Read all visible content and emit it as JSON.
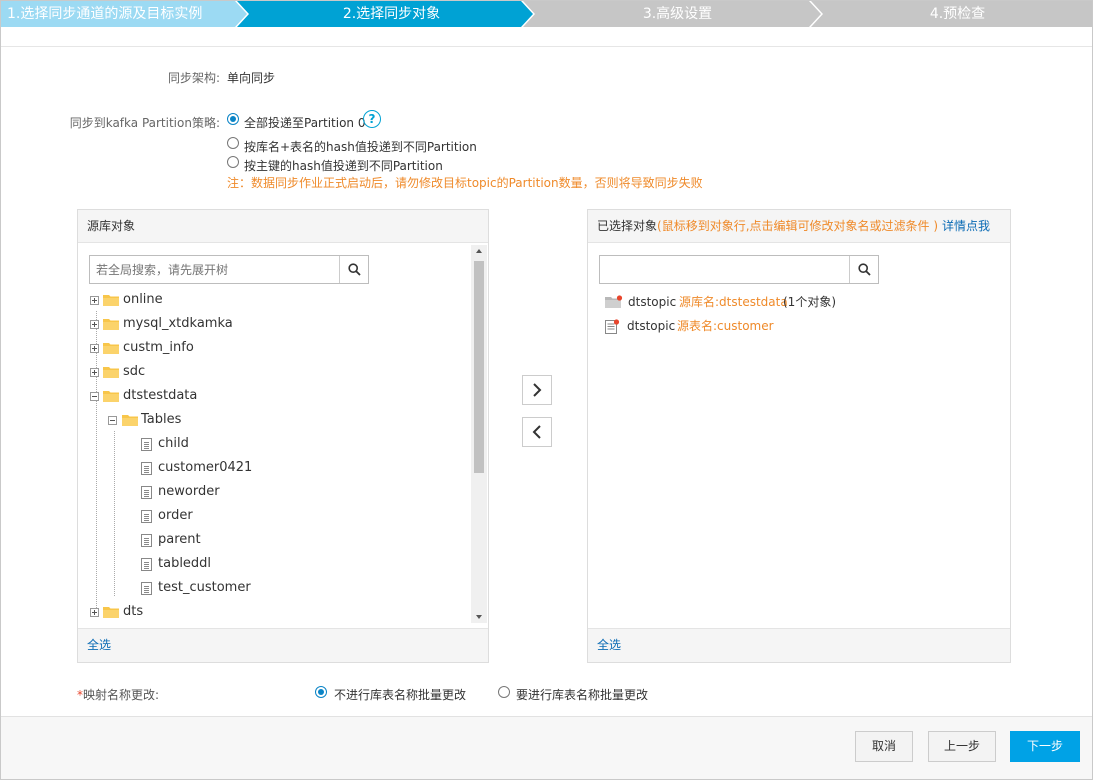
{
  "steps": [
    {
      "label": "1.选择同步通道的源及目标实例",
      "state": "done"
    },
    {
      "label": "2.选择同步对象",
      "state": "active"
    },
    {
      "label": "3.高级设置",
      "state": "pending"
    },
    {
      "label": "4.预检查",
      "state": "pending"
    }
  ],
  "colors": {
    "done": "#9cdaf3",
    "active": "#00a2d4",
    "pending": "#c6c6c6",
    "accent": "#0a84c6",
    "warn": "#ef8a2a"
  },
  "form": {
    "arch_label": "同步架构:",
    "arch_value": "单向同步",
    "partition_label": "同步到kafka Partition策略:",
    "partition_options": [
      {
        "label": "全部投递至Partition 0",
        "selected": true
      },
      {
        "label": "按库名+表名的hash值投递到不同Partition",
        "selected": false
      },
      {
        "label": "按主键的hash值投递到不同Partition",
        "selected": false
      }
    ],
    "help_glyph": "?",
    "warning": "注：数据同步作业正式启动后，请勿修改目标topic的Partition数量，否则将导致同步失败"
  },
  "source_panel": {
    "title": "源库对象",
    "search_placeholder": "若全局搜索，请先展开树",
    "select_all": "全选",
    "tree": [
      {
        "label": "online",
        "type": "db",
        "expanded": false
      },
      {
        "label": "mysql_xtdkamka",
        "type": "db",
        "expanded": false
      },
      {
        "label": "custm_info",
        "type": "db",
        "expanded": false
      },
      {
        "label": "sdc",
        "type": "db",
        "expanded": false
      },
      {
        "label": "dtstestdata",
        "type": "db",
        "expanded": true
      },
      {
        "label": "Tables",
        "type": "folder",
        "expanded": true
      },
      {
        "label": "child",
        "type": "table"
      },
      {
        "label": "customer0421",
        "type": "table"
      },
      {
        "label": "neworder",
        "type": "table"
      },
      {
        "label": "order",
        "type": "table"
      },
      {
        "label": "parent",
        "type": "table"
      },
      {
        "label": "tableddl",
        "type": "table"
      },
      {
        "label": "test_customer",
        "type": "table"
      },
      {
        "label": "dts",
        "type": "db",
        "expanded": false
      }
    ]
  },
  "target_panel": {
    "title": "已选择对象",
    "hint": "(鼠标移到对象行,点击编辑可修改对象名或过滤条件 )",
    "details_link": "详情点我",
    "search_placeholder": "",
    "select_all": "全选",
    "items": [
      {
        "name": "dtstopic",
        "source": "源库名:dtstestdata",
        "extra": "(1个对象)",
        "type": "db"
      },
      {
        "name": "dtstopic",
        "source": "源表名:customer",
        "extra": "",
        "type": "table"
      }
    ]
  },
  "mapping": {
    "label": "映射名称更改:",
    "required_mark": "*",
    "options": [
      {
        "label": "不进行库表名称批量更改",
        "selected": true
      },
      {
        "label": "要进行库表名称批量更改",
        "selected": false
      }
    ]
  },
  "footer": {
    "cancel": "取消",
    "prev": "上一步",
    "next": "下一步"
  }
}
